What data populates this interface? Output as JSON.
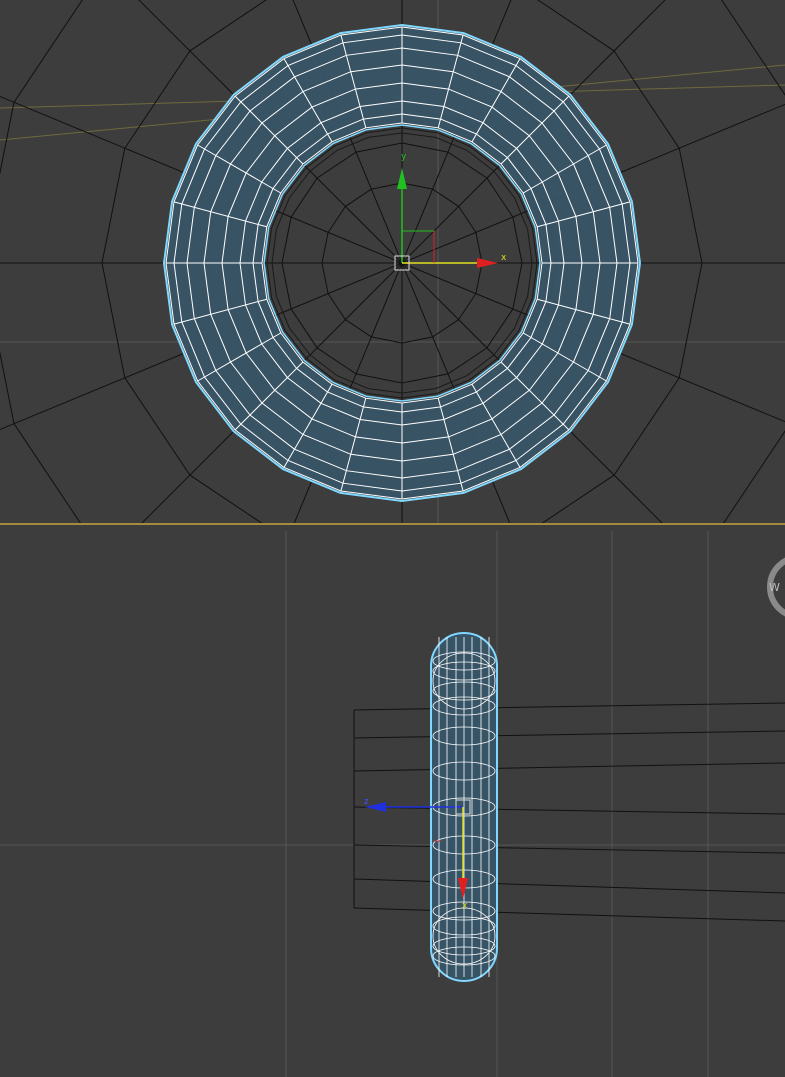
{
  "viewports": {
    "top": {
      "gizmo": {
        "x_label": "x",
        "y_label": "y"
      }
    },
    "side": {
      "gizmo": {
        "z_label": "z",
        "x_label": "x"
      },
      "nav_label": "W"
    }
  },
  "colors": {
    "background": "#3d3d3d",
    "grid": "#555555",
    "wire_black": "#111111",
    "torus_fill": "#375466",
    "torus_wire": "#ffffff",
    "selection_outline": "#7fd8ff",
    "axis_x": "#e02020",
    "axis_y": "#20c020",
    "axis_z": "#2030e0",
    "active_border": "#a48a3e"
  },
  "icons": [
    "transform-gizmo-icon",
    "pivot-point-icon",
    "viewcube-ring-icon"
  ]
}
